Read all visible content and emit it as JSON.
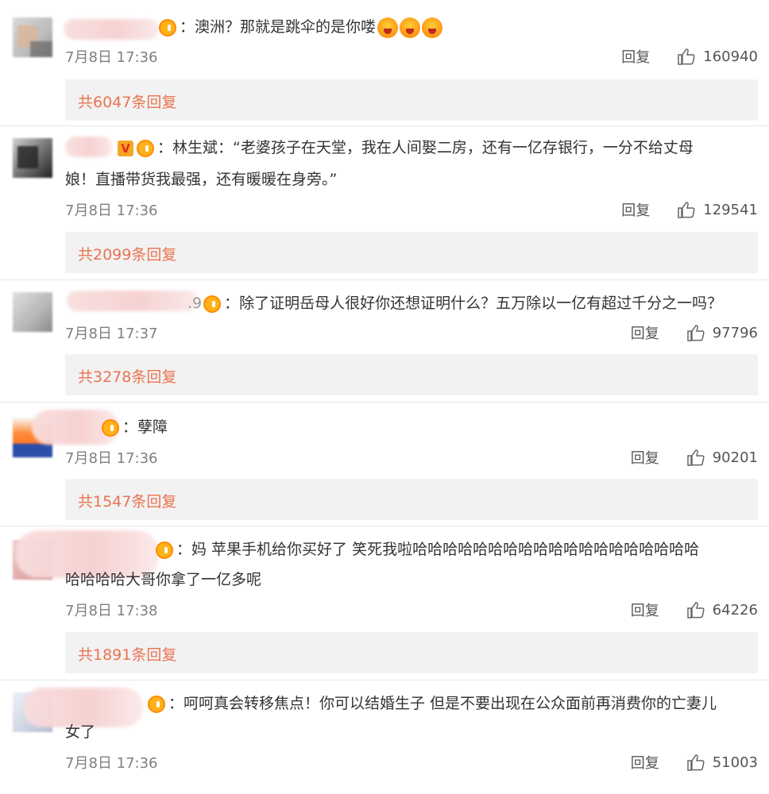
{
  "comments": [
    {
      "text_lines": [
        "：澳洲？那就是跳伞的是你喽"
      ],
      "time": "7月8日 17:36",
      "reply_label": "回复",
      "likes": "160940",
      "sub_replies": "共6047条回复",
      "emoji_count": 3
    },
    {
      "text_lines": [
        "：林生斌：“老婆孩子在天堂，我在人间娶二房，还有一亿存银行，一分不给丈母",
        "娘！直播带货我最强，还有暖暖在身旁。”"
      ],
      "time": "7月8日 17:36",
      "reply_label": "回复",
      "likes": "129541",
      "sub_replies": "共2099条回复",
      "vip_letter": "V"
    },
    {
      "name_tail": ".9",
      "text_lines": [
        "：除了证明岳母人很好你还想证明什么？五万除以一亿有超过千分之一吗？"
      ],
      "time": "7月8日 17:37",
      "reply_label": "回复",
      "likes": "97796",
      "sub_replies": "共3278条回复"
    },
    {
      "text_lines": [
        "：孽障"
      ],
      "time": "7月8日 17:36",
      "reply_label": "回复",
      "likes": "90201",
      "sub_replies": "共1547条回复"
    },
    {
      "text_lines": [
        "：妈 苹果手机给你买好了 笑死我啦哈哈哈哈哈哈哈哈哈哈哈哈哈哈哈哈哈哈哈",
        "哈哈哈哈大哥你拿了一亿多呢"
      ],
      "time": "7月8日 17:38",
      "reply_label": "回复",
      "likes": "64226",
      "sub_replies": "共1891条回复"
    },
    {
      "text_lines": [
        "：呵呵真会转移焦点！你可以结婚生子 但是不要出现在公众面前再消费你的亡妻儿",
        "女了"
      ],
      "time": "7月8日 17:36",
      "reply_label": "回复",
      "likes": "51003"
    }
  ],
  "colors": {
    "link": "#eb7350",
    "meta": "#7f7f7f",
    "sub_bar_bg": "#f2f2f2"
  },
  "icons": {
    "like": "thumb-up-icon",
    "level_badge": "crown-icon",
    "emoji": "angry-face-icon"
  }
}
